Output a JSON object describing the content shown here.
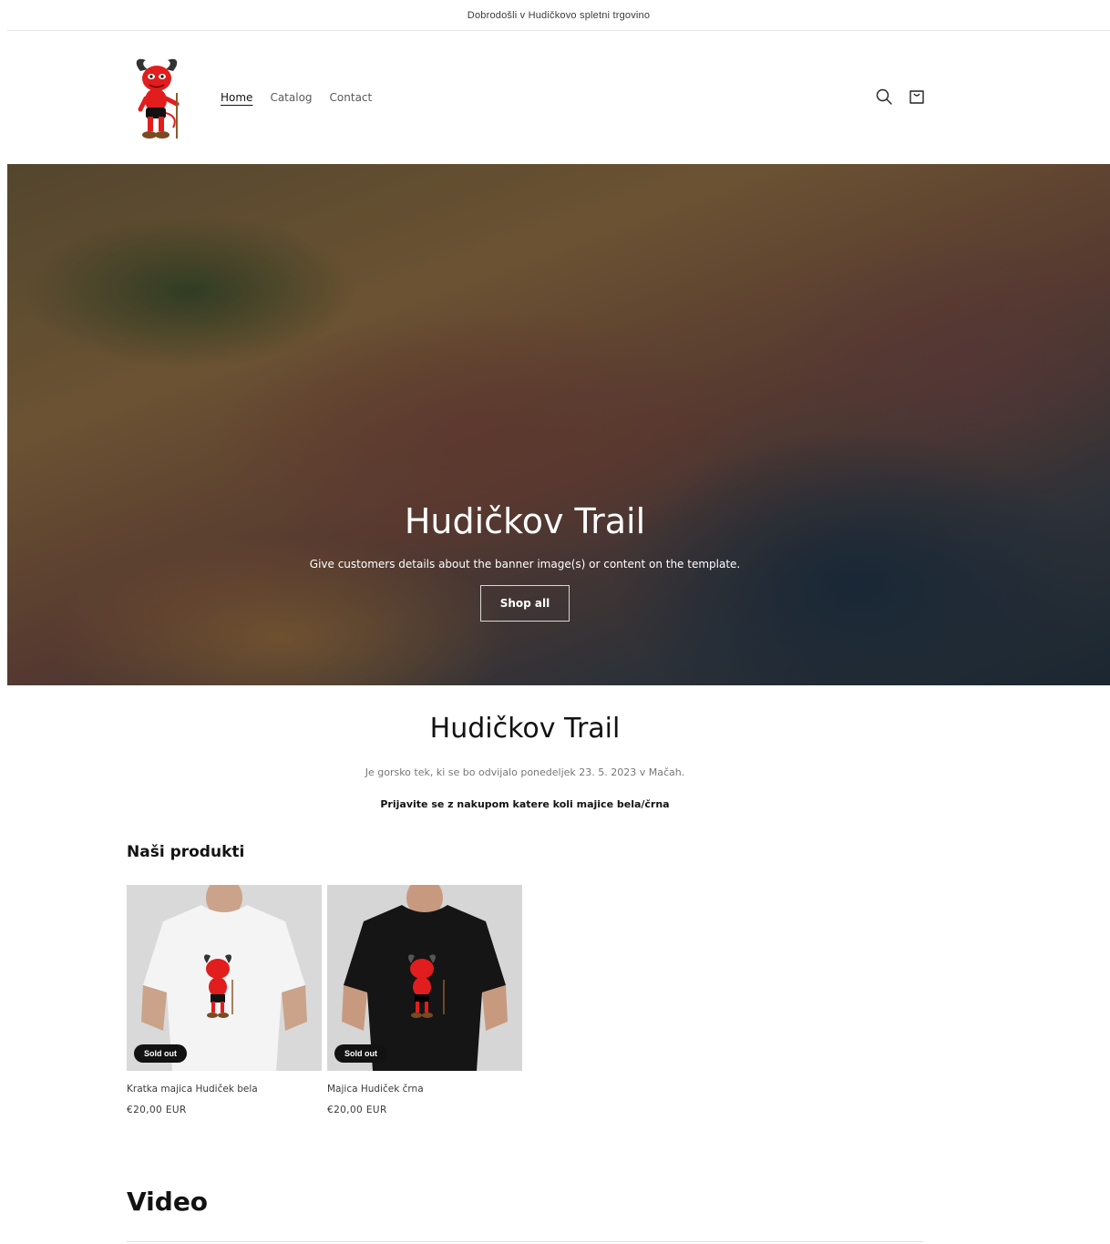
{
  "announcement": {
    "text": "Dobrodošli v Hudičkovo spletni trgovino"
  },
  "header": {
    "logo_icon": "devil-mascot-logo",
    "nav": [
      {
        "label": "Home",
        "active": true
      },
      {
        "label": "Catalog",
        "active": false
      },
      {
        "label": "Contact",
        "active": false
      }
    ],
    "icons": [
      "search-icon",
      "cart-icon"
    ]
  },
  "hero": {
    "title": "Hudičkov Trail",
    "subtitle": "Give customers details about the banner image(s) or content on the template.",
    "button_label": "Shop all"
  },
  "intro": {
    "title": "Hudičkov Trail",
    "body": "Je gorsko tek, ki se bo odvijalo ponedeljek 23. 5. 2023 v Mačah.",
    "highlight": "Prijavite se z nakupom katere koli majice bela/črna"
  },
  "products": {
    "heading": "Naši produkti",
    "items": [
      {
        "title": "Kratka majica Hudiček bela",
        "price": "€20,00 EUR",
        "badge": "Sold out",
        "shirt_color": "#f4f4f4"
      },
      {
        "title": "Majica Hudiček črna",
        "price": "€20,00 EUR",
        "badge": "Sold out",
        "shirt_color": "#151515"
      }
    ]
  },
  "video": {
    "heading": "Video"
  }
}
